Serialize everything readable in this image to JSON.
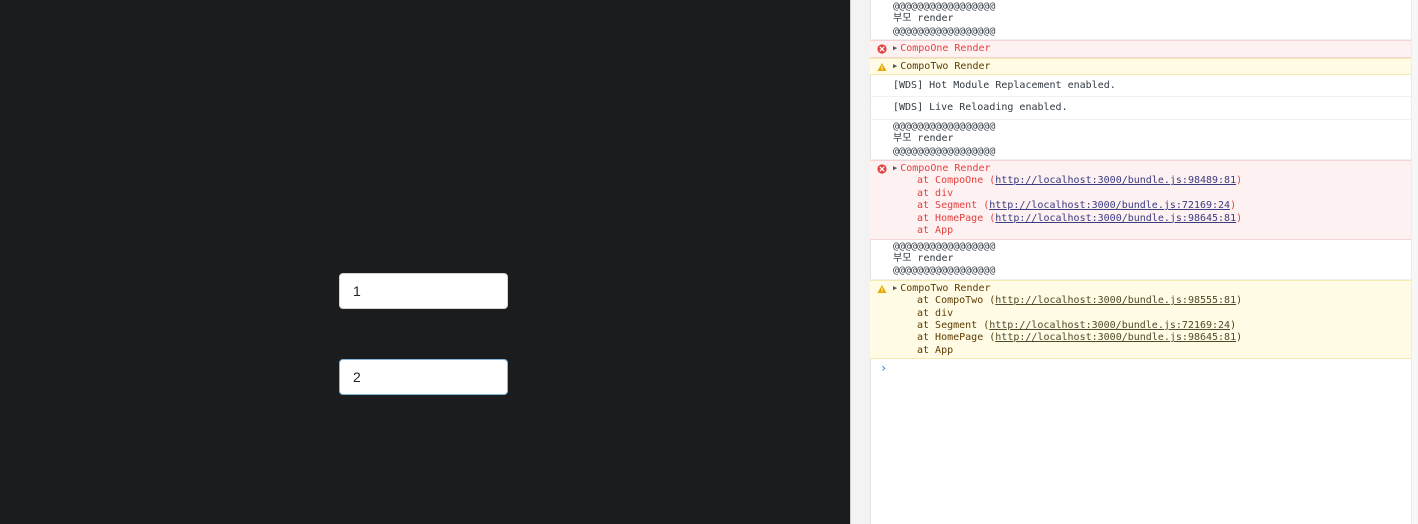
{
  "app": {
    "input1_value": "1",
    "input2_value": "2"
  },
  "console": {
    "messages": [
      {
        "level": "log",
        "lines": [
          "@@@@@@@@@@@@@@@@@",
          "부모 render",
          "@@@@@@@@@@@@@@@@@"
        ]
      },
      {
        "level": "error",
        "head": "CompoOne Render"
      },
      {
        "level": "warn",
        "head": "CompoTwo Render"
      },
      {
        "level": "log",
        "lines": [
          "[WDS] Hot Module Replacement enabled."
        ]
      },
      {
        "level": "log",
        "lines": [
          "[WDS] Live Reloading enabled."
        ]
      },
      {
        "level": "log",
        "lines": [
          "@@@@@@@@@@@@@@@@@",
          "부모 render",
          "@@@@@@@@@@@@@@@@@"
        ]
      },
      {
        "level": "error",
        "head": "CompoOne Render",
        "stack": [
          {
            "pre": "at CompoOne (",
            "link": "http://localhost:3000/bundle.js:98489:81",
            "post": ")"
          },
          {
            "pre": "at div"
          },
          {
            "pre": "at Segment (",
            "link": "http://localhost:3000/bundle.js:72169:24",
            "post": ")"
          },
          {
            "pre": "at HomePage (",
            "link": "http://localhost:3000/bundle.js:98645:81",
            "post": ")"
          },
          {
            "pre": "at App"
          }
        ]
      },
      {
        "level": "log",
        "lines": [
          "@@@@@@@@@@@@@@@@@",
          "부모 render",
          "@@@@@@@@@@@@@@@@@"
        ]
      },
      {
        "level": "warn",
        "head": "CompoTwo Render",
        "stack": [
          {
            "pre": "at CompoTwo (",
            "link": "http://localhost:3000/bundle.js:98555:81",
            "post": ")"
          },
          {
            "pre": "at div"
          },
          {
            "pre": "at Segment (",
            "link": "http://localhost:3000/bundle.js:72169:24",
            "post": ")"
          },
          {
            "pre": "at HomePage (",
            "link": "http://localhost:3000/bundle.js:98645:81",
            "post": ")"
          },
          {
            "pre": "at App"
          }
        ]
      }
    ],
    "prompt_symbol": "›"
  },
  "colors": {
    "error": "#e3413f",
    "warn": "#e6a700",
    "prompt": "#2f7de1"
  }
}
